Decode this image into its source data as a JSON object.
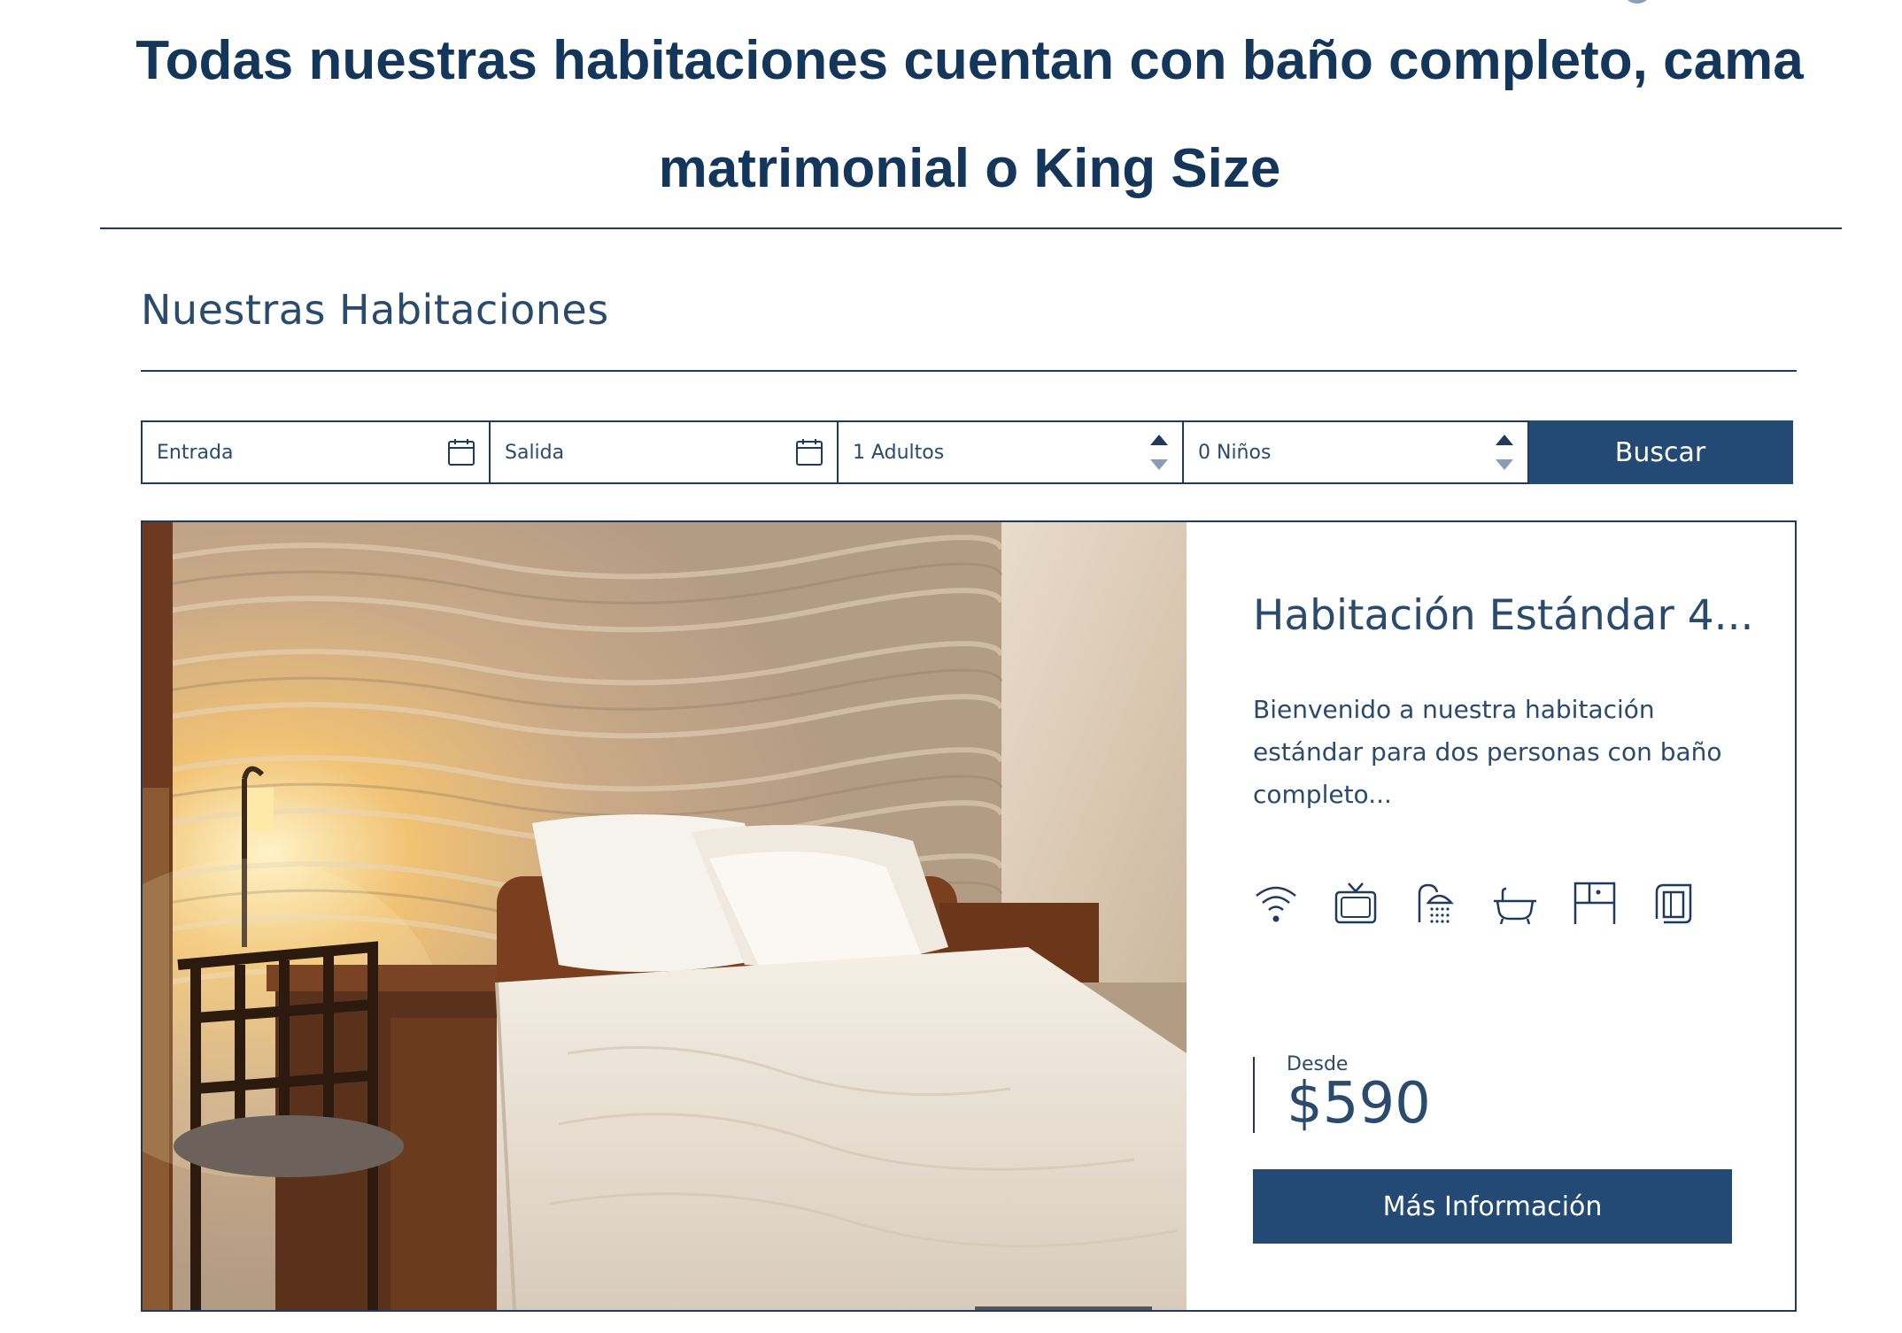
{
  "headline": {
    "line1": "Todas nuestras habitaciones cuentan con baño completo, cama",
    "line2": "matrimonial o King Size"
  },
  "section": {
    "title": "Nuestras Habitaciones"
  },
  "search": {
    "check_in": "Entrada",
    "check_out": "Salida",
    "adults": "1 Adultos",
    "children": "0 Niños",
    "button": "Buscar"
  },
  "room": {
    "name": "Habitación Estándar 4...",
    "description": "Bienvenido a nuestra habitación estándar para dos personas con baño completo...",
    "amenities": [
      "wifi-icon",
      "tv-icon",
      "shower-icon",
      "bathtub-icon",
      "wardrobe-icon",
      "towel-icon"
    ],
    "price_label": "Desde",
    "price": "$590",
    "button": "Más Información"
  },
  "colors": {
    "navy": "#1e3a5f",
    "button": "#234a74"
  }
}
